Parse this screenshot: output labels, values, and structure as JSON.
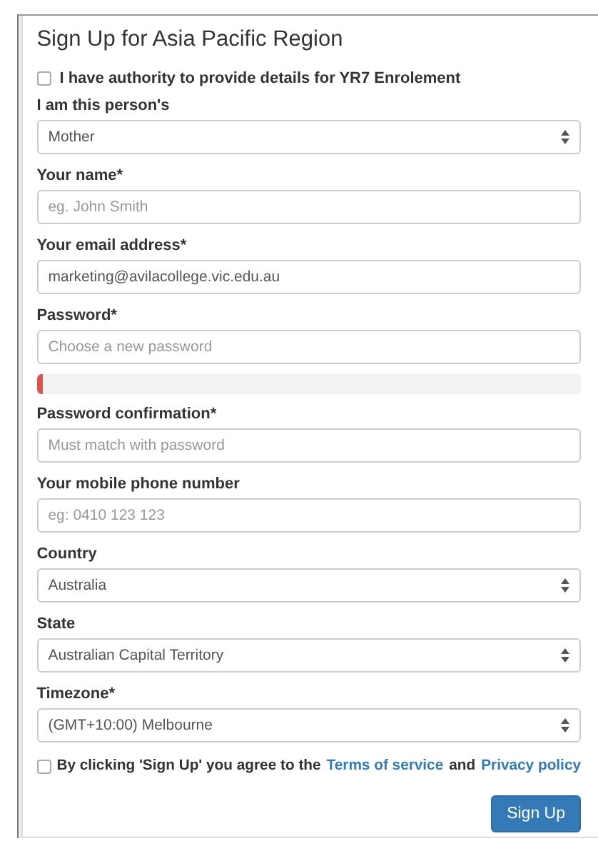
{
  "title": "Sign Up for Asia Pacific Region",
  "authority": {
    "checked": false,
    "label": "I have authority to provide details for YR7 Enrolement"
  },
  "fields": [
    {
      "kind": "select",
      "label": "I am this person's",
      "value": "Mother"
    },
    {
      "kind": "text",
      "label": "Your name",
      "required_mark": "*",
      "placeholder": "eg. John Smith"
    },
    {
      "kind": "text",
      "label": "Your email address",
      "required_mark": "*",
      "value": "marketing@avilacollege.vic.edu.au"
    },
    {
      "kind": "text",
      "label": "Password",
      "required_mark": "*",
      "placeholder": "Choose a new password"
    },
    {
      "kind": "meter",
      "level": 0.01
    },
    {
      "kind": "text",
      "label": "Password confirmation",
      "required_mark": "*",
      "placeholder": "Must match with password"
    },
    {
      "kind": "text",
      "label": "Your mobile phone number",
      "placeholder": "eg: 0410 123 123"
    },
    {
      "kind": "select",
      "label": "Country",
      "value": "Australia"
    },
    {
      "kind": "select",
      "label": "State",
      "value": "Australian Capital Territory"
    },
    {
      "kind": "select",
      "label": "Timezone",
      "required_mark": "*",
      "value": "(GMT+10:00) Melbourne"
    }
  ],
  "agree": {
    "checked": false,
    "parts": [
      {
        "kind": "text",
        "text": "By clicking 'Sign Up' you agree to the"
      },
      {
        "kind": "link",
        "text": "Terms of service"
      },
      {
        "kind": "text",
        "text": "and"
      },
      {
        "kind": "link",
        "text": "Privacy policy"
      }
    ]
  },
  "submit": "Sign Up"
}
